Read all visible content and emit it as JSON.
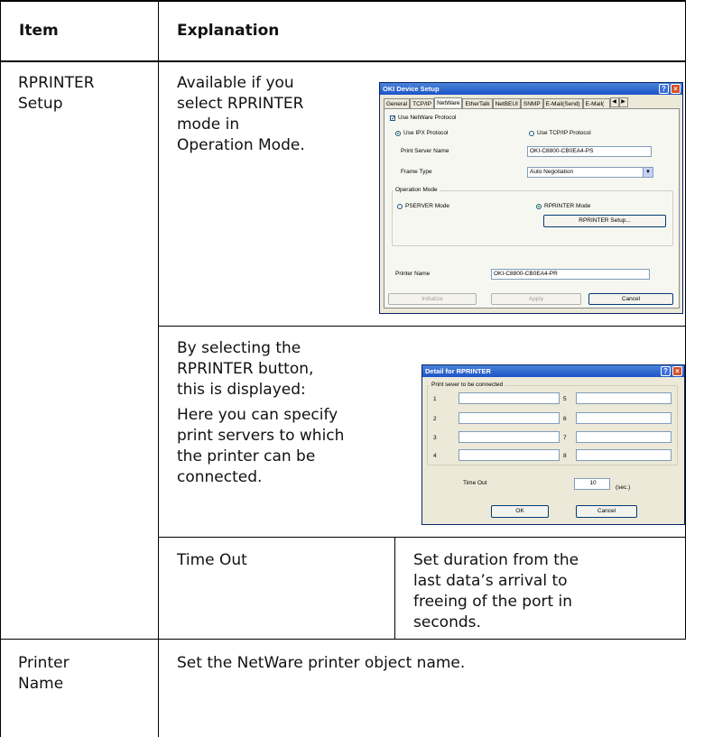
{
  "table": {
    "header": {
      "item": "Item",
      "explanation": "Explanation"
    },
    "row1": {
      "item": [
        "RPRINTER",
        "Setup"
      ],
      "explanation": [
        "Available if you",
        "select RPRINTER",
        "mode in",
        "Operation Mode."
      ]
    },
    "row2": {
      "explanation_a": [
        "By selecting the",
        "RPRINTER button,",
        "this is displayed:"
      ],
      "explanation_b": [
        "Here you can specify",
        "print servers to which",
        "the printer can be",
        "connected."
      ]
    },
    "row3": {
      "subitem": "Time Out",
      "explanation": [
        "Set duration from the",
        "last data’s arrival to",
        "freeing of the port in",
        "seconds."
      ]
    },
    "row4": {
      "item": [
        "Printer",
        "Name"
      ],
      "explanation": "Set the NetWare printer object name."
    }
  },
  "dialog1": {
    "title": "OKI Device Setup",
    "tabs": [
      "General",
      "TCP/IP",
      "NetWare",
      "EtherTalk",
      "NetBEUI",
      "SNMP",
      "E-Mail(Send)",
      "E-Mail("
    ],
    "active_tab": "NetWare",
    "use_netware": "Use NetWare Protocol",
    "use_ipx": "Use IPX Protocol",
    "use_tcpip": "Use TCP/IP Protocol",
    "print_server_name_label": "Print Server Name",
    "print_server_name_value": "OKI-C8800-CB0EA4-PS",
    "frame_type_label": "Frame Type",
    "frame_type_value": "Auto Negotiation",
    "operation_mode_label": "Operation Mode",
    "pserver_mode": "PSERVER Mode",
    "rprinter_mode": "RPRINTER Mode",
    "rprinter_setup_button": "RPRINTER Setup...",
    "printer_name_label": "Printer Name",
    "printer_name_value": "OKI-C8800-CB0EA4-PR",
    "initialize_button": "Initialize",
    "apply_button": "Apply",
    "cancel_button": "Cancel"
  },
  "dialog2": {
    "title": "Detail for RPRINTER",
    "group_label": "Print sever to be connected",
    "numbers": [
      "1",
      "2",
      "3",
      "4",
      "5",
      "6",
      "7",
      "8"
    ],
    "timeout_label": "Time Out",
    "timeout_value": "10",
    "timeout_unit": "(sec.)",
    "ok_button": "OK",
    "cancel_button": "Cancel"
  },
  "colors": {
    "border": "#000000",
    "titlebar": "#1c54c8",
    "dialog_bg": "#ece9d8"
  },
  "icons": [
    "help-icon",
    "close-icon",
    "tab-left-arrow-icon",
    "tab-right-arrow-icon",
    "dropdown-arrow-icon",
    "checkbox-checked-icon"
  ]
}
